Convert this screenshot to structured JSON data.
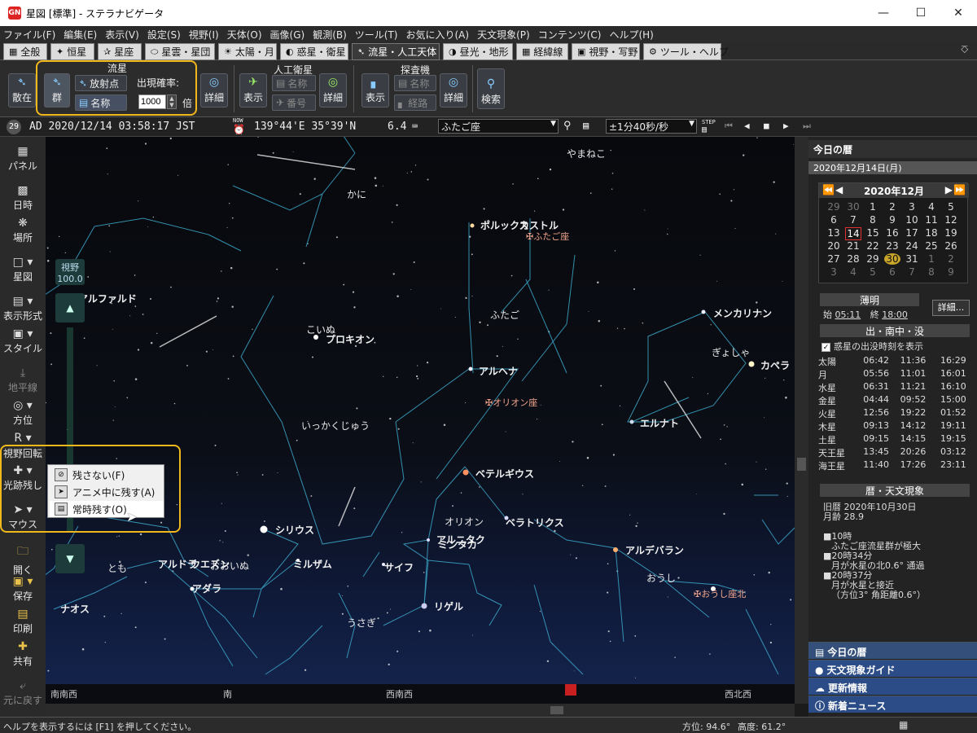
{
  "window": {
    "title": "星図 [標準] - ステラナビゲータ",
    "app_icon": "GN"
  },
  "menu": [
    "ファイル(F)",
    "編集(E)",
    "表示(V)",
    "設定(S)",
    "視野(I)",
    "天体(O)",
    "画像(G)",
    "観測(B)",
    "ツール(T)",
    "お気に入り(A)",
    "天文現象(P)",
    "コンテンツ(C)",
    "ヘルプ(H)"
  ],
  "tabs": [
    "全般",
    "恒星",
    "星座",
    "星雲・星団",
    "太陽・月",
    "惑星・衛星",
    "流星・人工天体",
    "昼光・地形",
    "経緯線",
    "視野・写野",
    "ツール・ヘルプ"
  ],
  "ribbon": {
    "meteor_group": "流星",
    "scatter": "散在",
    "shower": "群",
    "radiant": "放射点",
    "name": "名称",
    "rate_label": "出現確率:",
    "rate_value": "1000",
    "rate_unit": "倍",
    "detail": "詳細",
    "satellite_group": "人工衛星",
    "show": "表示",
    "sat_name": "名称",
    "sat_number": "番号",
    "probe_group": "探査機",
    "probe_name": "名称",
    "probe_path": "経路",
    "search": "検索"
  },
  "statusline": {
    "moon_age": "29",
    "datetime": "AD 2020/12/14 03:58:17 JST",
    "now": "NOW",
    "coords": "139°44'E 35°39'N",
    "magnitude": "6.4",
    "constellation": "ふたご座",
    "speed": "±1分40秒/秒",
    "step": "STEP"
  },
  "leftbar": {
    "panel": "パネル",
    "datetime": "日時",
    "place": "場所",
    "chart": "星図",
    "display": "表示形式",
    "style": "スタイル",
    "horizon": "地平線",
    "direction": "方位",
    "rotate": "視野回転",
    "trail": "光跡残し",
    "mouse": "マウス",
    "open": "開く",
    "save": "保存",
    "print": "印刷",
    "share": "共有",
    "undo": "元に戻す"
  },
  "popup": [
    "残さない(F)",
    "アニメ中に残す(A)",
    "常時残す(O)"
  ],
  "zoom": {
    "label": "視野",
    "value": "100.0"
  },
  "sky": {
    "stars": [
      "アルファルド",
      "ポルックス",
      "カストル",
      "こいぬ",
      "プロキオン",
      "メンカリナン",
      "カペラ",
      "アルヘナ",
      "エルナト",
      "ベテルギウス",
      "ベラトリクス",
      "アルニタク",
      "ミンタカ",
      "アルデバラン",
      "シリウス",
      "アルドラ",
      "ウエズン",
      "ミルザム",
      "アダラ",
      "サイフ",
      "リゲル",
      "ナオス"
    ],
    "constellations": [
      "やまねこ",
      "かに",
      "ふたご",
      "ぎょしゃ",
      "いっかくじゅう",
      "オリオン",
      "おおいぬ",
      "とも",
      "おうし",
      "うさぎ"
    ],
    "radiants": [
      "ふたご座",
      "オリオン座",
      "おうし座北"
    ],
    "directions": [
      "南南西",
      "南",
      "西南西",
      "西北西"
    ]
  },
  "rightpanel": {
    "today_title": "今日の暦",
    "date": "2020年12月14日(月)",
    "cal_title": "2020年12月",
    "cal_days": [
      "29",
      "30",
      "1",
      "2",
      "3",
      "4",
      "5",
      "6",
      "7",
      "8",
      "9",
      "10",
      "11",
      "12",
      "13",
      "14",
      "15",
      "16",
      "17",
      "18",
      "19",
      "20",
      "21",
      "22",
      "23",
      "24",
      "25",
      "26",
      "27",
      "28",
      "29",
      "30",
      "31",
      "1",
      "2",
      "3",
      "4",
      "5",
      "6",
      "7",
      "8",
      "9"
    ],
    "twilight_title": "薄明",
    "twilight_start_label": "始",
    "twilight_start": "05:11",
    "twilight_end_label": "終",
    "twilight_end": "18:00",
    "detail_btn": "詳細...",
    "rise_title": "出・南中・没",
    "planet_check": "惑星の出没時刻を表示",
    "rise_table": [
      [
        "太陽",
        "06:42",
        "11:36",
        "16:29"
      ],
      [
        "月",
        "05:56",
        "11:01",
        "16:01"
      ],
      [
        "水星",
        "06:31",
        "11:21",
        "16:10"
      ],
      [
        "金星",
        "04:44",
        "09:52",
        "15:00"
      ],
      [
        "火星",
        "12:56",
        "19:22",
        "01:52"
      ],
      [
        "木星",
        "09:13",
        "14:12",
        "19:11"
      ],
      [
        "土星",
        "09:15",
        "14:15",
        "19:15"
      ],
      [
        "天王星",
        "13:45",
        "20:26",
        "03:12"
      ],
      [
        "海王星",
        "11:40",
        "17:26",
        "23:11"
      ]
    ],
    "events_title": "暦・天文現象",
    "old_cal": "旧暦  2020年10月30日",
    "moon_age": "月齢 28.9",
    "events": [
      "■10時",
      "ふたご座流星群が極大",
      "■20時34分",
      "月が水星の北0.6° 通過",
      "■20時37分",
      "月が水星と接近",
      "（方位3° 角距離0.6°）"
    ],
    "bottom": [
      "今日の暦",
      "天文現象ガイド",
      "更新情報",
      "新着ニュース"
    ]
  },
  "statusbar": {
    "help": "ヘルプを表示するには [F1] を押してください。",
    "azimuth": "方位:  94.6°",
    "altitude": "高度:  61.2°"
  },
  "colors": {
    "highlight": "#f1b81c",
    "line": "#3ba7c9",
    "sky_bottom": "#15254f"
  }
}
